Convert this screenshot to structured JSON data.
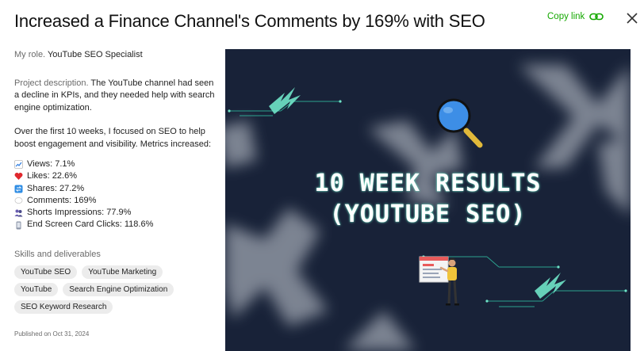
{
  "header": {
    "title": "Increased a Finance Channel's Comments by 169% with SEO",
    "copy_link_label": "Copy link"
  },
  "details": {
    "role_label": "My role.",
    "role_value": "YouTube SEO Specialist",
    "description_label": "Project description.",
    "description_value": "The YouTube channel had seen a decline in KPIs, and they needed help with search engine optimization.",
    "paragraph": "Over the first 10 weeks, I focused on SEO to help boost engagement and visibility. Metrics increased:",
    "metrics": [
      {
        "icon": "chart-increasing-icon",
        "label": "Views: 7.1%"
      },
      {
        "icon": "red-heart-icon",
        "label": "Likes: 22.6%"
      },
      {
        "icon": "share-icon",
        "label": "Shares: 27.2%"
      },
      {
        "icon": "speech-bubble-icon",
        "label": "Comments: 169%"
      },
      {
        "icon": "people-icon",
        "label": "Shorts Impressions: 77.9%"
      },
      {
        "icon": "mobile-phone-icon",
        "label": "End Screen Card Clicks: 118.6%"
      }
    ],
    "skills_label": "Skills and deliverables",
    "skills": [
      "YouTube SEO",
      "YouTube Marketing",
      "YouTube",
      "Search Engine Optimization",
      "SEO Keyword Research"
    ],
    "published": "Published on Oct 31, 2024"
  },
  "hero": {
    "title": "10 WEEK RESULTS",
    "subtitle": "(YOUTUBE SEO)",
    "background_color": "#182238",
    "accent_color": "#6fe4c8"
  },
  "colors": {
    "link_green": "#14a800",
    "chip_bg": "#ececec"
  }
}
